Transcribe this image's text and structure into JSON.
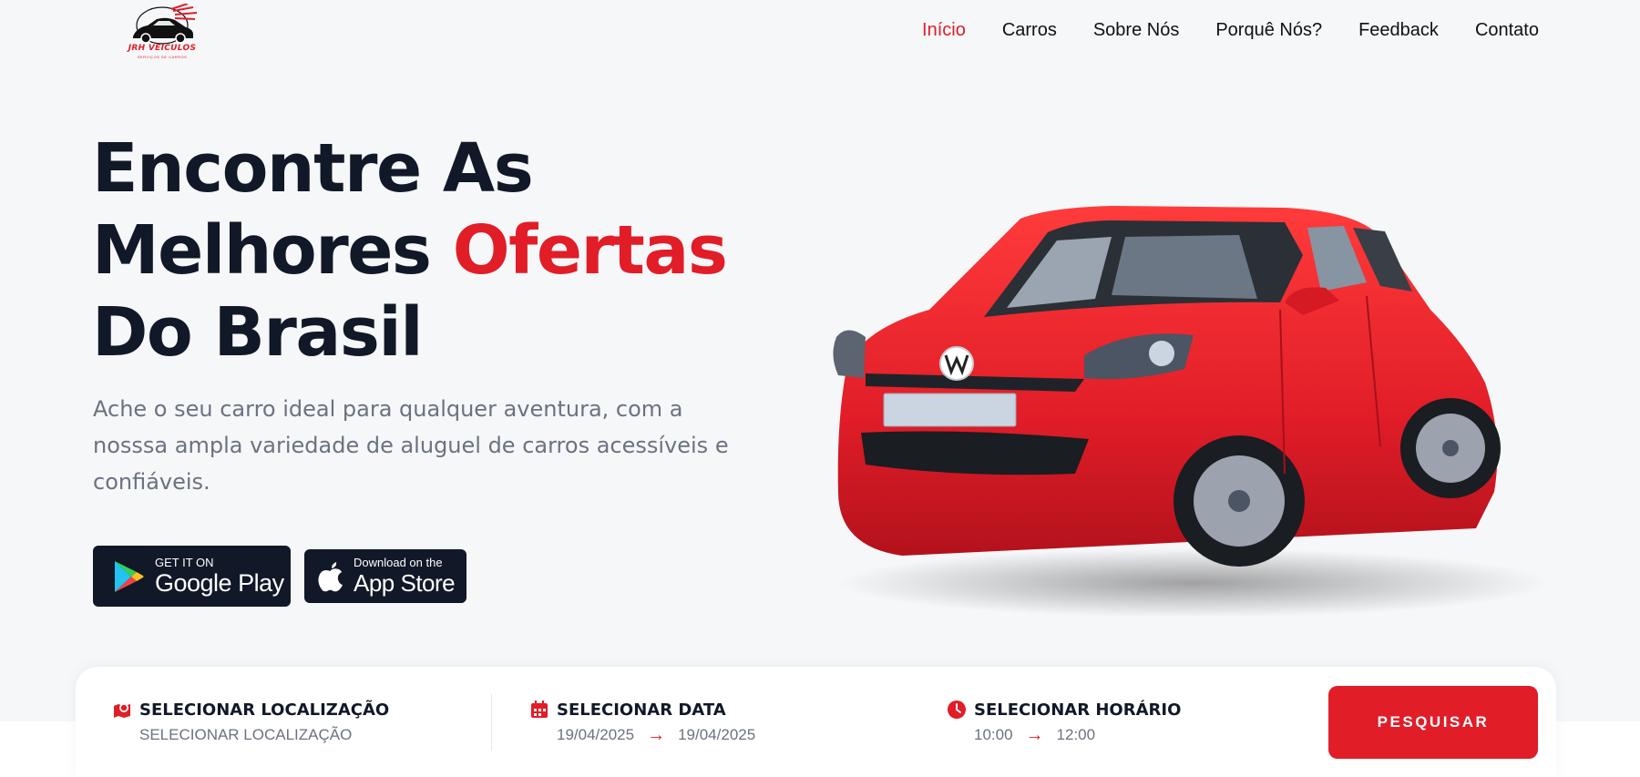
{
  "brand": {
    "name": "JRH VEICULOS",
    "tagline": "SERVIÇOS DE CARROS",
    "accent_color": "#e11d28",
    "dark_color": "#111827"
  },
  "nav": {
    "items": [
      "Início",
      "Carros",
      "Sobre Nós",
      "Porquê Nós?",
      "Feedback",
      "Contato"
    ],
    "active": "Início"
  },
  "hero": {
    "headline_line1": "Encontre As",
    "headline_line2_a": "Melhores",
    "headline_line2_b": "Ofertas",
    "headline_line3": "Do Brasil",
    "subtitle": "Ache o seu carro ideal para qualquer aventura, com a nosssa ampla variedade de aluguel de carros acessíveis e confiáveis.",
    "image_alt": "red-volkswagen-hatchback"
  },
  "store_buttons": {
    "google_play": {
      "small": "GET IT ON",
      "big": "Google Play",
      "icon": "google-play-icon"
    },
    "app_store": {
      "small": "Download on the",
      "big": "App Store",
      "icon": "apple-icon"
    }
  },
  "search": {
    "location": {
      "icon": "map-pin-icon",
      "title": "SELECIONAR LOCALIZAÇÃO",
      "value": "SELECIONAR LOCALIZAÇÃO"
    },
    "date": {
      "icon": "calendar-icon",
      "title": "SELECIONAR DATA",
      "start": "19/04/2025",
      "end": "19/04/2025"
    },
    "time": {
      "icon": "clock-icon",
      "title": "SELECIONAR HORÁRIO",
      "start": "10:00",
      "end": "12:00"
    },
    "arrow": "→",
    "button_label": "PESQUISAR"
  }
}
